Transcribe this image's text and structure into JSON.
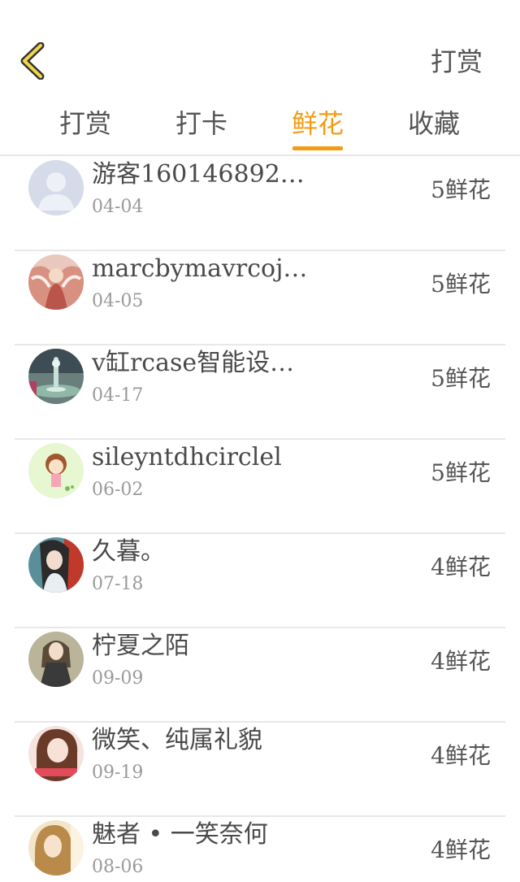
{
  "header": {
    "action_label": "打赏"
  },
  "tabs": [
    {
      "label": "打赏",
      "active": false
    },
    {
      "label": "打卡",
      "active": false
    },
    {
      "label": "鲜花",
      "active": true
    },
    {
      "label": "收藏",
      "active": false
    }
  ],
  "colors": {
    "accent": "#f39c12",
    "text_primary": "#4a4a4a",
    "text_secondary": "#9a9a9a",
    "divider": "#e8e8e8",
    "back_icon_fill": "#f2d64b"
  },
  "icons": {
    "back": "chevron-left-icon"
  },
  "rows": [
    {
      "name": "游客160146892…",
      "date": "04-04",
      "amount": "5鲜花",
      "avatar": "default-avatar"
    },
    {
      "name": "marcbymavrcoj…",
      "date": "04-05",
      "amount": "5鲜花",
      "avatar": "angel-avatar"
    },
    {
      "name": "v缸rcase智能设…",
      "date": "04-17",
      "amount": "5鲜花",
      "avatar": "water-drop-avatar"
    },
    {
      "name": "sileyntdhcirclel",
      "date": "06-02",
      "amount": "5鲜花",
      "avatar": "cartoon-girl-avatar"
    },
    {
      "name": "久暮。",
      "date": "07-18",
      "amount": "4鲜花",
      "avatar": "girl-avatar"
    },
    {
      "name": "柠夏之陌",
      "date": "09-09",
      "amount": "4鲜花",
      "avatar": "dress-girl-avatar"
    },
    {
      "name": "微笑、纯属礼貌",
      "date": "09-19",
      "amount": "4鲜花",
      "avatar": "portrait-avatar"
    },
    {
      "name": "魅者 • 一笑奈何",
      "date": "08-06",
      "amount": "4鲜花",
      "avatar": "blonde-avatar"
    }
  ]
}
